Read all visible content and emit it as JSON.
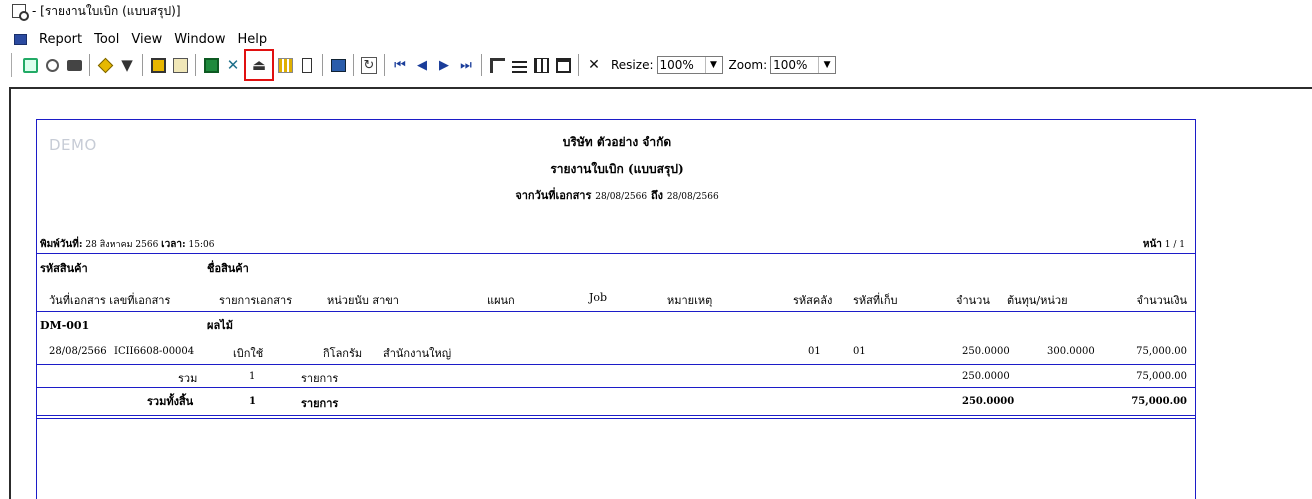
{
  "window": {
    "title": "- [รายงานใบเบิก (แบบสรุป)]"
  },
  "menu": [
    "Report",
    "Tool",
    "View",
    "Window",
    "Help"
  ],
  "toolbar": {
    "resize_label": "Resize:",
    "resize_value": "100%",
    "zoom_label": "Zoom:",
    "zoom_value": "100%",
    "highlighted_tool": "export-tool-icon"
  },
  "report": {
    "watermark": "DEMO",
    "company": "บริษัท ตัวอย่าง จำกัด",
    "title": "รายงานใบเบิก (แบบสรุป)",
    "date_range": {
      "from_label": "จากวันที่เอกสาร",
      "from": "28/08/2566",
      "to_label": "ถึง",
      "to": "28/08/2566"
    },
    "printed": {
      "date_label": "พิมพ์วันที่:",
      "date": "28 สิงหาคม 2566",
      "time_label": "เวลา:",
      "time": "15:06"
    },
    "page": {
      "label": "หน้า",
      "value": "1 / 1"
    },
    "headers_row1": {
      "product_code": "รหัสสินค้า",
      "product_name": "ชื่อสินค้า"
    },
    "headers_row2": {
      "doc_date_no": "วันที่เอกสาร เลขที่เอกสาร",
      "doc_item": "รายการเอกสาร",
      "unit_branch": "หน่วยนับ สาขา",
      "department": "แผนก",
      "job": "Job",
      "note": "หมายเหตุ",
      "warehouse": "รหัสคลัง",
      "location": "รหัสที่เก็บ",
      "qty": "จำนวน",
      "unit_cost": "ต้นทุน/หน่วย",
      "amount": "จำนวนเงิน"
    },
    "product": {
      "code": "DM-001",
      "name": "ผลไม้"
    },
    "line": {
      "date": "28/08/2566",
      "doc_no": "ICII6608-00004",
      "doc_item": "เบิกใช้",
      "unit": "กิโลกรัม",
      "branch": "สำนักงานใหญ่",
      "warehouse": "01",
      "location": "01",
      "qty": "250.0000",
      "unit_cost": "300.0000",
      "amount": "75,000.00"
    },
    "subtotal": {
      "label": "รวม",
      "count": "1",
      "unit": "รายการ",
      "qty": "250.0000",
      "amount": "75,000.00"
    },
    "grand_total": {
      "label": "รวมทั้งสิ้น",
      "count": "1",
      "unit": "รายการ",
      "qty": "250.0000",
      "amount": "75,000.00"
    }
  }
}
